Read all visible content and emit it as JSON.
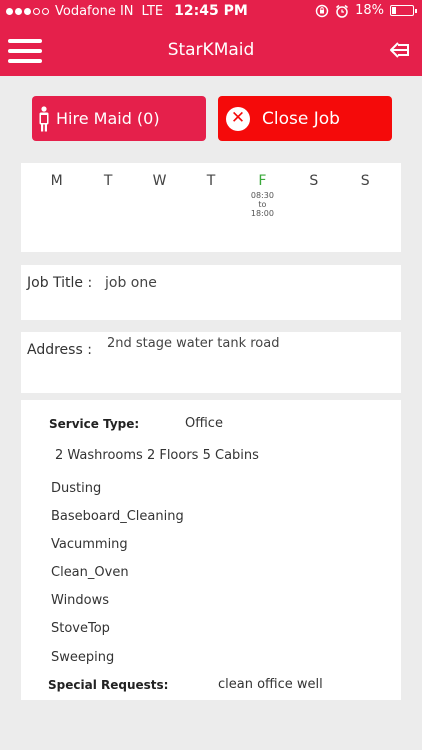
{
  "status_bar": {
    "carrier": "Vodafone IN",
    "network": "LTE",
    "time": "12:45 PM",
    "battery": "18%",
    "battery_level": 0.18,
    "signal_bars_filled": 3,
    "signal_bars_total": 5
  },
  "nav": {
    "title": "StarKMaid"
  },
  "actions": {
    "hire_label": "Hire Maid (0)",
    "close_label": "Close Job"
  },
  "schedule": {
    "days": [
      {
        "letter": "M",
        "time": "",
        "active": false
      },
      {
        "letter": "T",
        "time": "",
        "active": false
      },
      {
        "letter": "W",
        "time": "",
        "active": false
      },
      {
        "letter": "T",
        "time": "",
        "active": false
      },
      {
        "letter": "F",
        "time_from": "08:30",
        "time_to_word": "to",
        "time_until": "18:00",
        "active": true
      },
      {
        "letter": "S",
        "time": "",
        "active": false
      },
      {
        "letter": "S",
        "time": "",
        "active": false
      }
    ]
  },
  "job": {
    "title_label": "Job Title :",
    "title_value": "job one",
    "address_label": "Address :",
    "address_value": "2nd stage water  tank  road"
  },
  "details": {
    "service_type_label": "Service Type:",
    "service_type_value": "Office",
    "rooms": "2 Washrooms  2 Floors  5 Cabins",
    "tasks": [
      "Dusting",
      "Baseboard_Cleaning",
      "Vacumming",
      "Clean_Oven",
      "Windows",
      "StoveTop",
      "Sweeping"
    ],
    "special_label": "Special Requests:",
    "special_value": "clean office  well"
  },
  "colors": {
    "primary": "#e5204b",
    "close_button": "#f50a0a",
    "active_day": "#3aa83a",
    "background": "#ececec"
  }
}
